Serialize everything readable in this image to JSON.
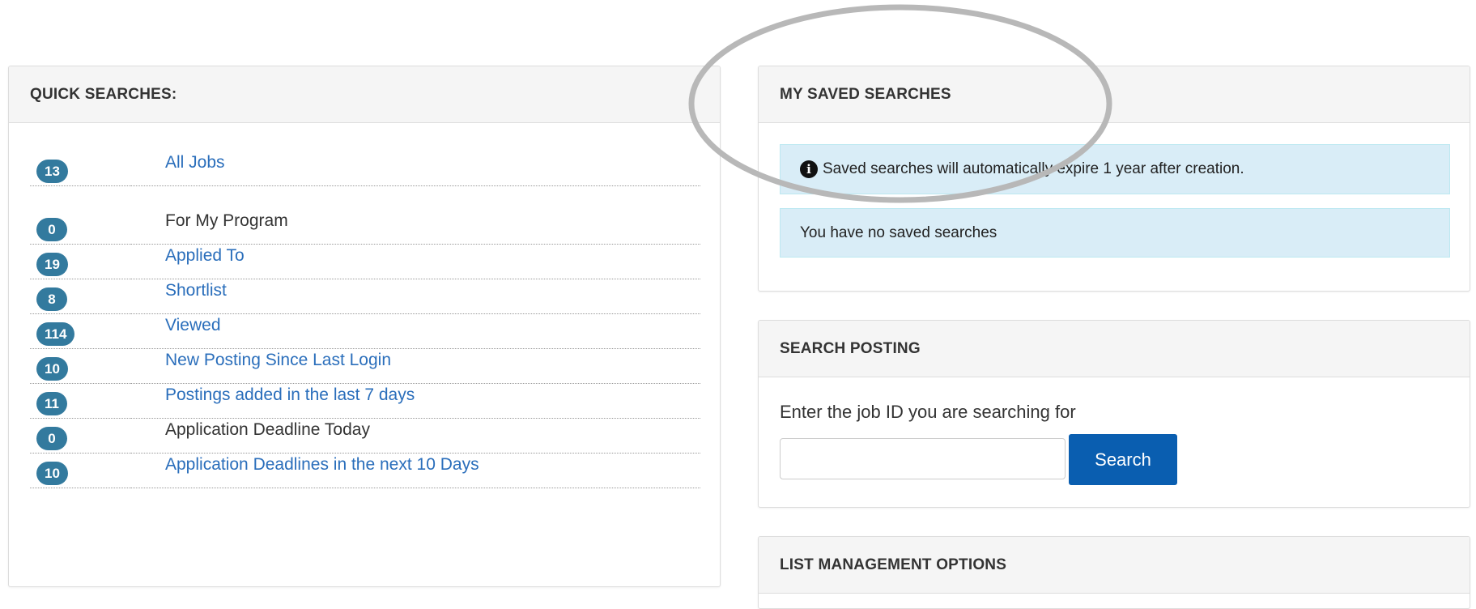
{
  "quick_searches": {
    "title": "QUICK SEARCHES:",
    "items": [
      {
        "count": "13",
        "label": "All Jobs",
        "link": true
      },
      {
        "count": "0",
        "label": "For My Program",
        "link": false
      },
      {
        "count": "19",
        "label": "Applied To",
        "link": true
      },
      {
        "count": "8",
        "label": "Shortlist",
        "link": true
      },
      {
        "count": "114",
        "label": "Viewed",
        "link": true
      },
      {
        "count": "10",
        "label": "New Posting Since Last Login",
        "link": true
      },
      {
        "count": "11",
        "label": "Postings added in the last 7 days",
        "link": true
      },
      {
        "count": "0",
        "label": "Application Deadline Today",
        "link": false
      },
      {
        "count": "10",
        "label": "Application Deadlines in the next 10 Days",
        "link": true
      }
    ]
  },
  "saved_searches": {
    "title": "MY SAVED SEARCHES",
    "info_message": "Saved searches will automatically expire 1 year after creation.",
    "empty_message": "You have no saved searches",
    "info_icon": "info-circle-icon"
  },
  "search_posting": {
    "title": "SEARCH POSTING",
    "prompt": "Enter the job ID you are searching for",
    "input_value": "",
    "button_label": "Search"
  },
  "list_management": {
    "title": "LIST MANAGEMENT OPTIONS"
  },
  "colors": {
    "badge": "#337a9e",
    "link": "#2a6ebb",
    "button": "#0a5eb0",
    "alert_bg": "#d9edf7",
    "highlight": "#b8b8b8"
  }
}
